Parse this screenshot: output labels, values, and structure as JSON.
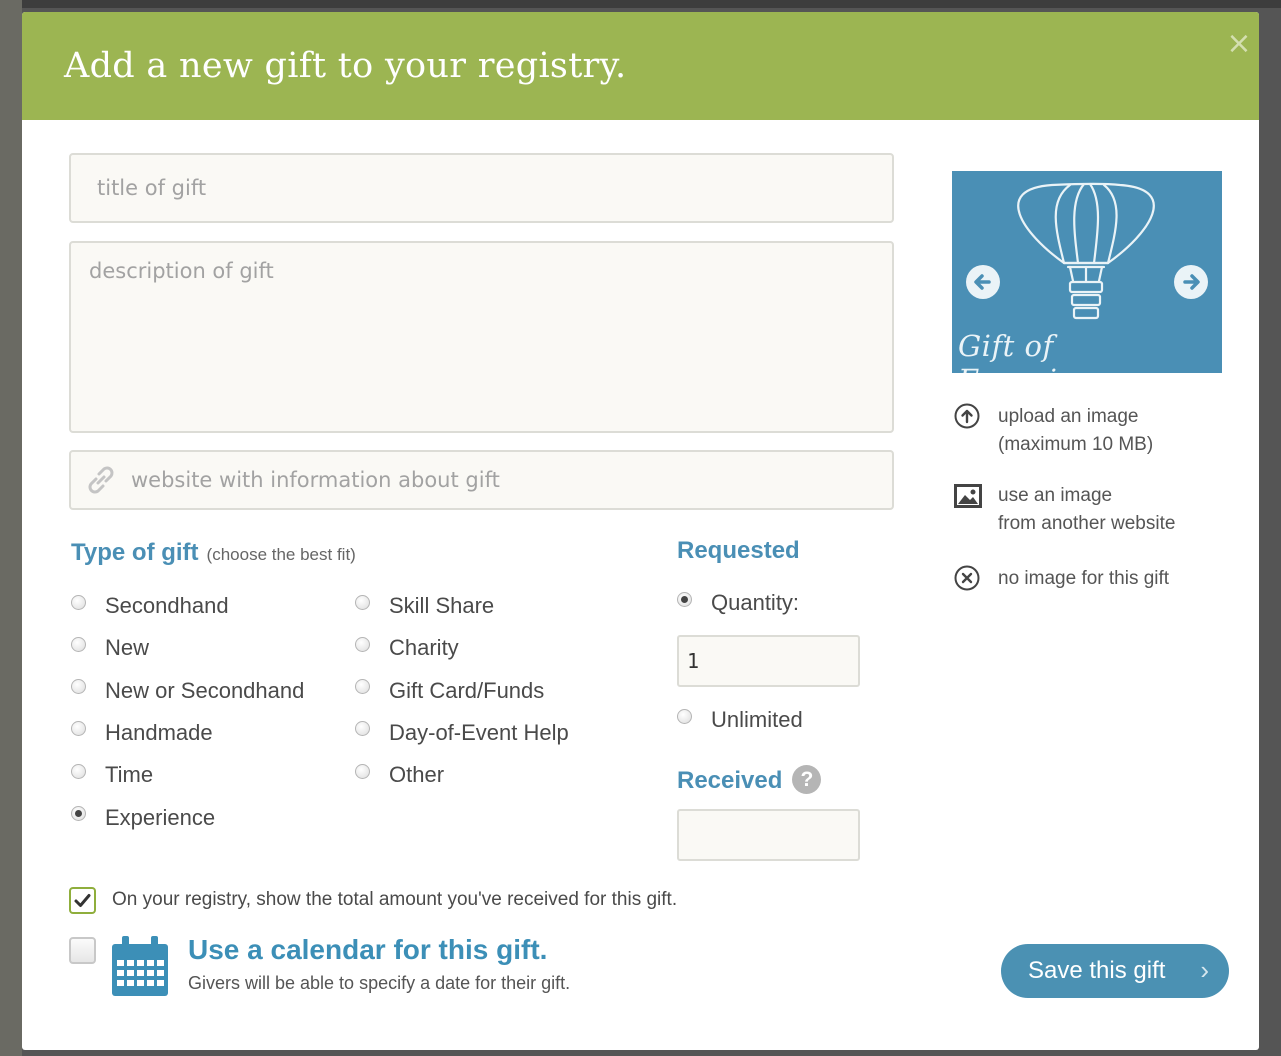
{
  "modal": {
    "title": "Add a new gift to your registry.",
    "close_label": "×"
  },
  "form": {
    "title_placeholder": "title of gift",
    "description_placeholder": "description of gift",
    "url_placeholder": "website with information about gift"
  },
  "type_of_gift": {
    "label": "Type of gift",
    "hint": "(choose the best fit)",
    "selected": "Experience",
    "options_col1": [
      "Secondhand",
      "New",
      "New or Secondhand",
      "Handmade",
      "Time",
      "Experience"
    ],
    "options_col2": [
      "Skill Share",
      "Charity",
      "Gift Card/Funds",
      "Day-of-Event Help",
      "Other"
    ]
  },
  "requested": {
    "label": "Requested",
    "quantity_label": "Quantity:",
    "quantity_value": "1",
    "unlimited_label": "Unlimited",
    "selected": "Quantity:"
  },
  "received": {
    "label": "Received",
    "help_icon": "?",
    "value": ""
  },
  "options": {
    "show_total_label": "On your registry, show the total amount you've received for this gift.",
    "show_total_checked": true,
    "calendar_label": "Use a calendar for this gift.",
    "calendar_sub": "Givers will be able to specify a date for their gift.",
    "calendar_checked": false
  },
  "image_panel": {
    "caption": "Gift of Experience",
    "background_color": "#4a8fb5",
    "upload_line1": "upload an image",
    "upload_line2": "(maximum 10 MB)",
    "web_line1": "use an image",
    "web_line2": "from another website",
    "none_label": "no image for this gift"
  },
  "actions": {
    "save_label": "Save this gift",
    "save_chevron": "›"
  },
  "colors": {
    "header": "#9cb552",
    "accent_blue": "#4a8fb5",
    "button": "#4b91b3"
  }
}
